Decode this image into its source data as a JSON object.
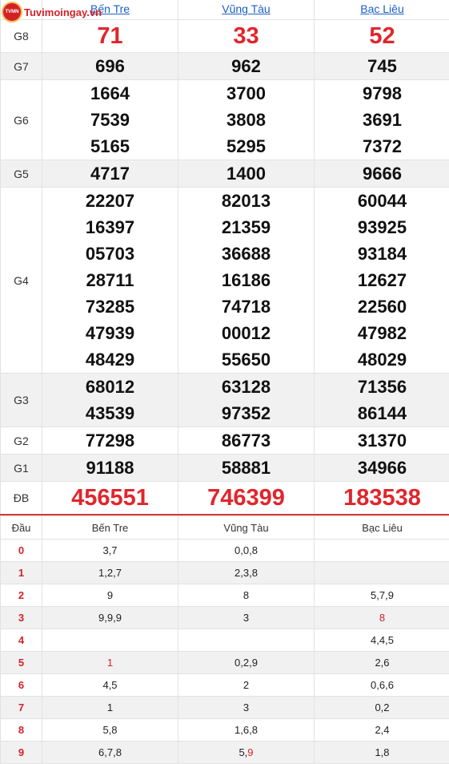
{
  "logo": {
    "text": "Tuvimoingay.vn",
    "badge": "TVMN"
  },
  "provinces": [
    "Bến Tre",
    "Vũng Tàu",
    "Bạc Liêu"
  ],
  "prizes": [
    {
      "label": "G8",
      "values": [
        [
          "71"
        ],
        [
          "33"
        ],
        [
          "52"
        ]
      ]
    },
    {
      "label": "G7",
      "values": [
        [
          "696"
        ],
        [
          "962"
        ],
        [
          "745"
        ]
      ]
    },
    {
      "label": "G6",
      "values": [
        [
          "1664",
          "7539",
          "5165"
        ],
        [
          "3700",
          "3808",
          "5295"
        ],
        [
          "9798",
          "3691",
          "7372"
        ]
      ]
    },
    {
      "label": "G5",
      "values": [
        [
          "4717"
        ],
        [
          "1400"
        ],
        [
          "9666"
        ]
      ]
    },
    {
      "label": "G4",
      "values": [
        [
          "22207",
          "16397",
          "05703",
          "28711",
          "73285",
          "47939",
          "48429"
        ],
        [
          "82013",
          "21359",
          "36688",
          "16186",
          "74718",
          "00012",
          "55650"
        ],
        [
          "60044",
          "93925",
          "93184",
          "12627",
          "22560",
          "47982",
          "48029"
        ]
      ]
    },
    {
      "label": "G3",
      "values": [
        [
          "68012",
          "43539"
        ],
        [
          "63128",
          "97352"
        ],
        [
          "71356",
          "86144"
        ]
      ]
    },
    {
      "label": "G2",
      "values": [
        [
          "77298"
        ],
        [
          "86773"
        ],
        [
          "31370"
        ]
      ]
    },
    {
      "label": "G1",
      "values": [
        [
          "91188"
        ],
        [
          "58881"
        ],
        [
          "34966"
        ]
      ]
    },
    {
      "label": "ĐB",
      "values": [
        [
          "456551"
        ],
        [
          "746399"
        ],
        [
          "183538"
        ]
      ]
    }
  ],
  "loto": {
    "header": {
      "dau": "Đầu",
      "provinces": [
        "Bến Tre",
        "Vũng Tàu",
        "Bạc Liêu"
      ]
    },
    "rows": [
      {
        "dau": "0",
        "cols": [
          [
            {
              "t": "3,7"
            }
          ],
          [
            {
              "t": "0,0,8"
            }
          ],
          []
        ]
      },
      {
        "dau": "1",
        "cols": [
          [
            {
              "t": "1,2,7"
            }
          ],
          [
            {
              "t": "2,3,8"
            }
          ],
          []
        ]
      },
      {
        "dau": "2",
        "cols": [
          [
            {
              "t": "9"
            }
          ],
          [
            {
              "t": "8"
            }
          ],
          [
            {
              "t": "5,7,9"
            }
          ]
        ]
      },
      {
        "dau": "3",
        "cols": [
          [
            {
              "t": "9,9,9"
            }
          ],
          [
            {
              "t": "3"
            }
          ],
          [
            {
              "t": "8",
              "red": true
            }
          ]
        ]
      },
      {
        "dau": "4",
        "cols": [
          [],
          [],
          [
            {
              "t": "4,4,5"
            }
          ]
        ]
      },
      {
        "dau": "5",
        "cols": [
          [
            {
              "t": "1",
              "red": true
            }
          ],
          [
            {
              "t": "0,2,9"
            }
          ],
          [
            {
              "t": "2,6"
            }
          ]
        ]
      },
      {
        "dau": "6",
        "cols": [
          [
            {
              "t": "4,5"
            }
          ],
          [
            {
              "t": "2"
            }
          ],
          [
            {
              "t": "0,6,6"
            }
          ]
        ]
      },
      {
        "dau": "7",
        "cols": [
          [
            {
              "t": "1"
            }
          ],
          [
            {
              "t": "3"
            }
          ],
          [
            {
              "t": "0,2"
            }
          ]
        ]
      },
      {
        "dau": "8",
        "cols": [
          [
            {
              "t": "5,8"
            }
          ],
          [
            {
              "t": "1,6,8"
            }
          ],
          [
            {
              "t": "2,4"
            }
          ]
        ]
      },
      {
        "dau": "9",
        "cols": [
          [
            {
              "t": "6,7,8"
            }
          ],
          [
            {
              "t": "5,"
            },
            {
              "t": "9",
              "red": true
            }
          ],
          [
            {
              "t": "1,8"
            }
          ]
        ]
      }
    ]
  },
  "colors": {
    "accent_red": "#e0262d",
    "link_blue": "#1a5ec7",
    "alt_row": "#f1f1f1"
  }
}
